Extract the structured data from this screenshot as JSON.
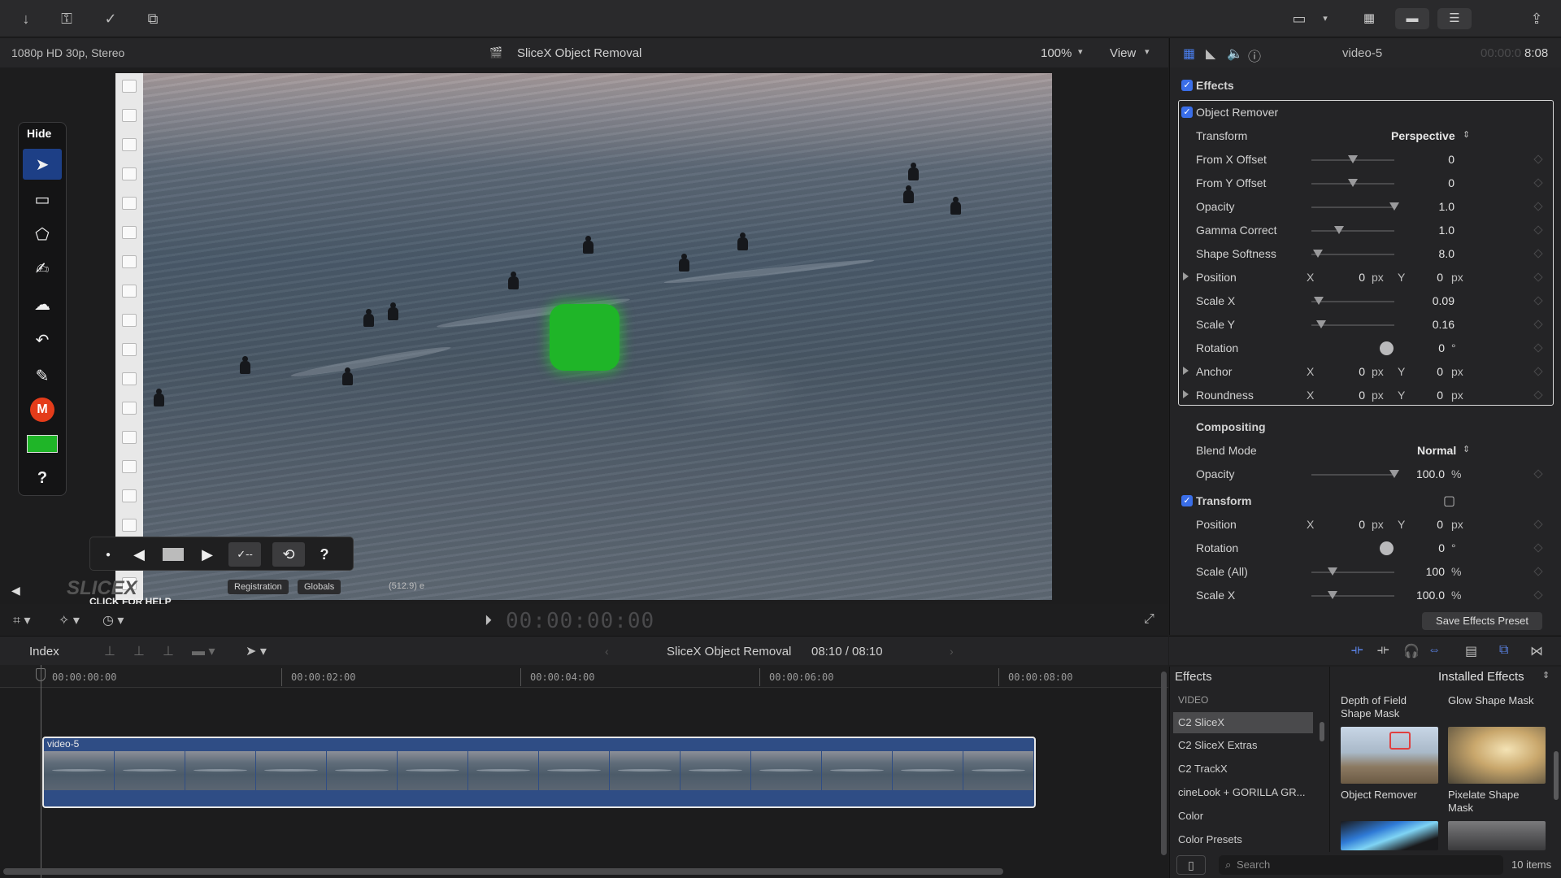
{
  "viewer": {
    "format": "1080p HD 30p, Stereo",
    "title": "SliceX Object Removal",
    "zoom": "100%",
    "view_label": "View",
    "timecode": "00:00:00:00"
  },
  "palette": {
    "hide_label": "Hide",
    "tools": [
      "arrow-pointer-icon",
      "rectangle-icon",
      "polygon-icon",
      "freehand-icon",
      "cloud-icon",
      "undo-icon",
      "brush-icon",
      "m-logo-icon",
      "green-color-swatch",
      "help-icon"
    ],
    "mask_color": "#1fb528",
    "help_glyph": "?"
  },
  "viewer_controls": {
    "check_label": "✓--",
    "help_glyph": "?",
    "registration_label": "Registration",
    "globals_label": "Globals",
    "coords": "(512.9) e",
    "slicex_logo": "SLICEX",
    "click_help": "CLICK FOR HELP"
  },
  "inspector": {
    "clip_name": "video-5",
    "duration_prefix": "00:00:0",
    "duration_suffix": "8:08",
    "effects_label": "Effects",
    "object_remover": {
      "title": "Object Remover",
      "transform_label": "Transform",
      "transform_value": "Perspective",
      "from_x_offset": {
        "label": "From X Offset",
        "value": "0",
        "level": 0.5
      },
      "from_y_offset": {
        "label": "From Y Offset",
        "value": "0",
        "level": 0.5
      },
      "opacity": {
        "label": "Opacity",
        "value": "1.0",
        "level": 1.0
      },
      "gamma_correct": {
        "label": "Gamma Correct",
        "value": "1.0",
        "level": 0.33
      },
      "shape_softness": {
        "label": "Shape Softness",
        "value": "8.0",
        "level": 0.08
      },
      "position": {
        "label": "Position",
        "x": "0",
        "y": "0",
        "unit": "px"
      },
      "scale_x": {
        "label": "Scale X",
        "value": "0.09",
        "level": 0.09
      },
      "scale_y": {
        "label": "Scale Y",
        "value": "0.16",
        "level": 0.12
      },
      "rotation": {
        "label": "Rotation",
        "value": "0",
        "unit": "°"
      },
      "anchor": {
        "label": "Anchor",
        "x": "0",
        "y": "0",
        "unit": "px"
      },
      "roundness": {
        "label": "Roundness",
        "x": "0",
        "y": "0",
        "unit": "px"
      }
    },
    "compositing": {
      "title": "Compositing",
      "blend_mode_label": "Blend Mode",
      "blend_mode_value": "Normal",
      "opacity_label": "Opacity",
      "opacity_value": "100.0",
      "opacity_unit": "%",
      "opacity_level": 1.0
    },
    "transform": {
      "title": "Transform",
      "position": {
        "label": "Position",
        "x": "0",
        "y": "0",
        "unit": "px"
      },
      "rotation": {
        "label": "Rotation",
        "value": "0",
        "unit": "°"
      },
      "scale_all": {
        "label": "Scale (All)",
        "value": "100",
        "unit": "%",
        "level": 0.25
      },
      "scale_x": {
        "label": "Scale X",
        "value": "100.0",
        "unit": "%",
        "level": 0.25
      }
    },
    "x_label": "X",
    "y_label": "Y",
    "save_preset": "Save Effects Preset"
  },
  "timeline": {
    "index_label": "Index",
    "project": "SliceX Object Removal",
    "position": "08:10 / 08:10",
    "ruler": [
      "00:00:00:00",
      "00:00:02:00",
      "00:00:04:00",
      "00:00:06:00",
      "00:00:08:00"
    ],
    "clip_name": "video-5"
  },
  "effects_browser": {
    "title": "Effects",
    "filter": "Installed Effects",
    "categories": [
      "VIDEO",
      "C2 SliceX",
      "C2 SliceX Extras",
      "C2 TrackX",
      "cineLook + GORILLA GR...",
      "Color",
      "Color Presets"
    ],
    "selected_category": 1,
    "items": [
      "Depth of Field Shape Mask",
      "Glow Shape Mask",
      "Object Remover",
      "Pixelate Shape Mask"
    ],
    "search_placeholder": "Search",
    "count": "10 items"
  },
  "colors": {
    "accent": "#3a6ee8",
    "selection": "#1d3f86",
    "clip": "#2f4d85"
  }
}
